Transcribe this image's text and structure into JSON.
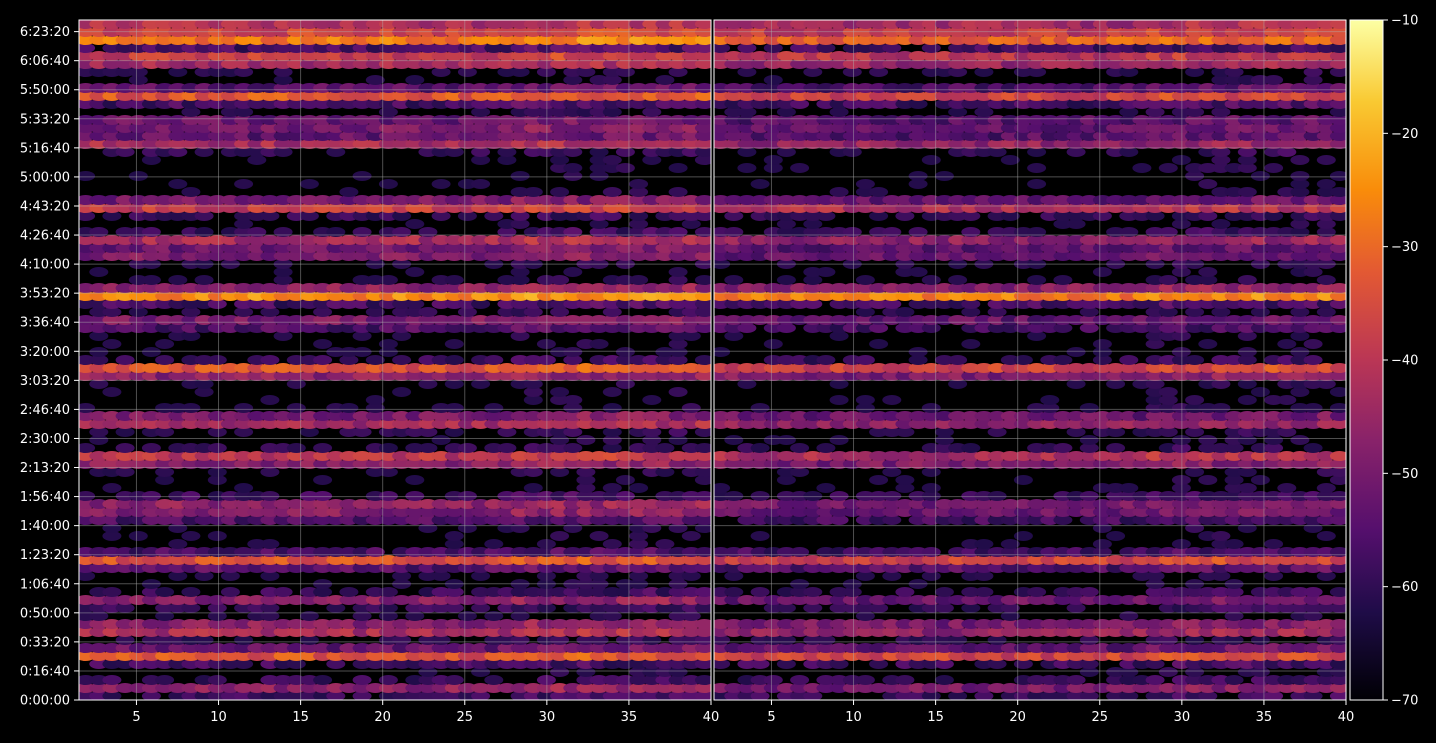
{
  "chart_data": [
    {
      "type": "heatmap",
      "panel": "left",
      "xlabel": "",
      "ylabel": "",
      "xlim": [
        1.5,
        40
      ],
      "ylim": [
        0,
        23400
      ],
      "x_tick_labels": [
        "5",
        "10",
        "15",
        "20",
        "25",
        "30",
        "35",
        "40"
      ],
      "y_tick_labels": [
        "0:00:00",
        "0:16:40",
        "0:33:20",
        "0:50:00",
        "1:06:40",
        "1:23:20",
        "1:40:00",
        "1:56:40",
        "2:13:20",
        "2:30:00",
        "2:46:40",
        "3:03:20",
        "3:20:00",
        "3:36:40",
        "3:53:20",
        "4:10:00",
        "4:26:40",
        "4:43:20",
        "5:00:00",
        "5:16:40",
        "5:33:20",
        "5:50:00",
        "6:06:40",
        "6:23:20"
      ],
      "grid": true,
      "value_range": [
        -70,
        -10
      ],
      "band_levels_by_time_seconds": [
        {
          "t": 23100,
          "level": -30
        },
        {
          "t": 22750,
          "level": -27
        },
        {
          "t": 22050,
          "level": -32
        },
        {
          "t": 20800,
          "level": -33
        },
        {
          "t": 19800,
          "level": -46
        },
        {
          "t": 19200,
          "level": -41
        },
        {
          "t": 17000,
          "level": -36
        },
        {
          "t": 15800,
          "level": -43
        },
        {
          "t": 15400,
          "level": -45
        },
        {
          "t": 13950,
          "level": -24
        },
        {
          "t": 13000,
          "level": -48
        },
        {
          "t": 11350,
          "level": -31
        },
        {
          "t": 9600,
          "level": -40
        },
        {
          "t": 8300,
          "level": -36
        },
        {
          "t": 6750,
          "level": -47
        },
        {
          "t": 6400,
          "level": -47
        },
        {
          "t": 4800,
          "level": -34
        },
        {
          "t": 3450,
          "level": -48
        },
        {
          "t": 2450,
          "level": -38
        },
        {
          "t": 1550,
          "level": -33
        },
        {
          "t": 400,
          "level": -47
        }
      ]
    },
    {
      "type": "heatmap",
      "panel": "right",
      "xlabel": "",
      "ylabel": "",
      "xlim": [
        1.5,
        40
      ],
      "ylim": [
        0,
        23400
      ],
      "x_tick_labels": [
        "5",
        "10",
        "15",
        "20",
        "25",
        "30",
        "35",
        "40"
      ],
      "grid": true,
      "value_range": [
        -70,
        -10
      ],
      "band_levels_by_time_seconds": [
        {
          "t": 23100,
          "level": -33
        },
        {
          "t": 22750,
          "level": -31
        },
        {
          "t": 22050,
          "level": -35
        },
        {
          "t": 20800,
          "level": -37
        },
        {
          "t": 19800,
          "level": -50
        },
        {
          "t": 19200,
          "level": -45
        },
        {
          "t": 17000,
          "level": -40
        },
        {
          "t": 15800,
          "level": -47
        },
        {
          "t": 15400,
          "level": -49
        },
        {
          "t": 13950,
          "level": -26
        },
        {
          "t": 13000,
          "level": -52
        },
        {
          "t": 11350,
          "level": -34
        },
        {
          "t": 9600,
          "level": -44
        },
        {
          "t": 8300,
          "level": -39
        },
        {
          "t": 6750,
          "level": -51
        },
        {
          "t": 6400,
          "level": -51
        },
        {
          "t": 4800,
          "level": -37
        },
        {
          "t": 3450,
          "level": -52
        },
        {
          "t": 2450,
          "level": -42
        },
        {
          "t": 1550,
          "level": -36
        },
        {
          "t": 400,
          "level": -50
        }
      ]
    }
  ],
  "colorbar": {
    "colormap": "inferno",
    "min": -70,
    "max": -10,
    "tick_labels": [
      "−10",
      "−20",
      "−30",
      "−40",
      "−50",
      "−60",
      "−70"
    ]
  },
  "colors": {
    "background": "#000000",
    "text": "#ffffff",
    "grid": "#b0b0b0"
  }
}
